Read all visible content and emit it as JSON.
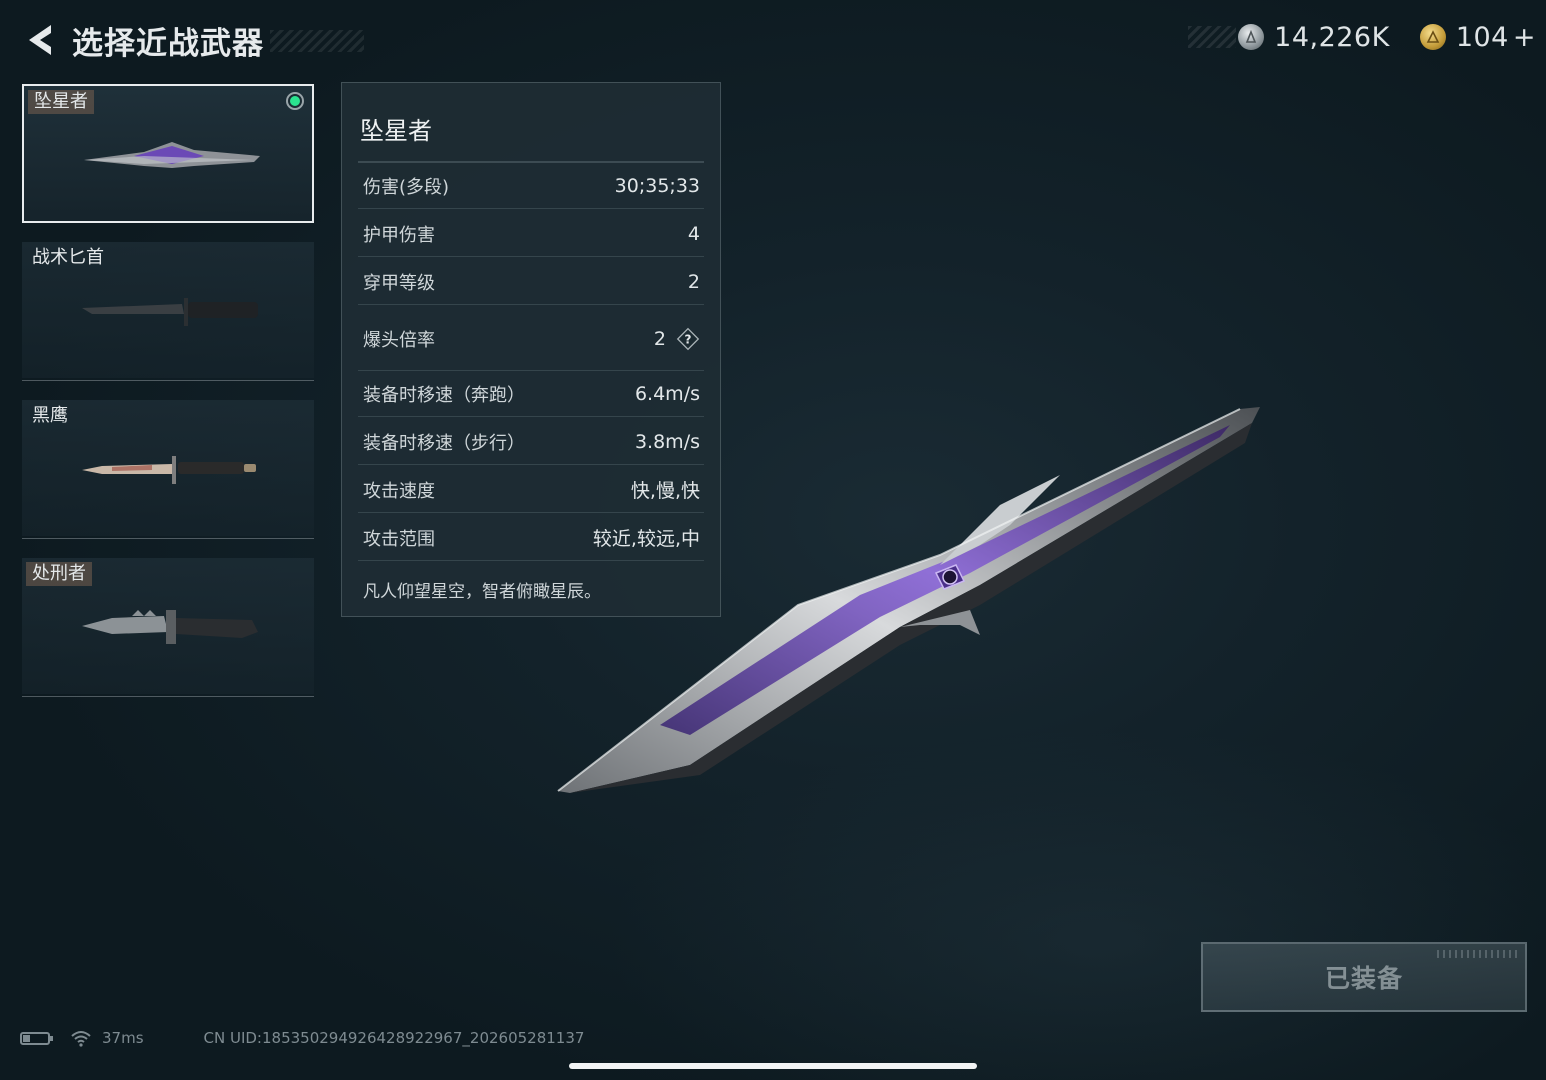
{
  "header": {
    "back_icon": "chevron-left-icon",
    "title": "选择近战武器"
  },
  "currency": {
    "silver": {
      "icon": "silver-coin-icon",
      "amount": "14,226K"
    },
    "gold": {
      "icon": "gold-coin-icon",
      "amount": "104",
      "add_label": "+"
    }
  },
  "weapons": [
    {
      "name": "坠星者",
      "selected": true,
      "equipped": true,
      "tagged": true
    },
    {
      "name": "战术匕首",
      "selected": false,
      "equipped": false,
      "tagged": false
    },
    {
      "name": "黑鹰",
      "selected": false,
      "equipped": false,
      "tagged": false
    },
    {
      "name": "处刑者",
      "selected": false,
      "equipped": false,
      "tagged": true
    }
  ],
  "stats": {
    "title": "坠星者",
    "rows": [
      {
        "label": "伤害(多段)",
        "value": "30;35;33"
      },
      {
        "label": "护甲伤害",
        "value": "4"
      },
      {
        "label": "穿甲等级",
        "value": "2"
      },
      {
        "label": "爆头倍率",
        "value": "2",
        "has_help": true
      },
      {
        "label": "装备时移速（奔跑）",
        "value": "6.4m/s"
      },
      {
        "label": "装备时移速（步行）",
        "value": "3.8m/s"
      },
      {
        "label": "攻击速度",
        "value": "快,慢,快"
      },
      {
        "label": "攻击范围",
        "value": "较近,较远,中"
      }
    ],
    "description": "凡人仰望星空，智者俯瞰星辰。"
  },
  "equip_button": {
    "label": "已装备"
  },
  "status_bar": {
    "ping": "37ms",
    "uid": "CN UID:1853502949264289229​67_202605281137"
  },
  "colors": {
    "background": "#0f1c23",
    "panel": "#1e2c34",
    "equipped_dot": "#2be38f",
    "accent_purple": "#7a4fc9"
  }
}
